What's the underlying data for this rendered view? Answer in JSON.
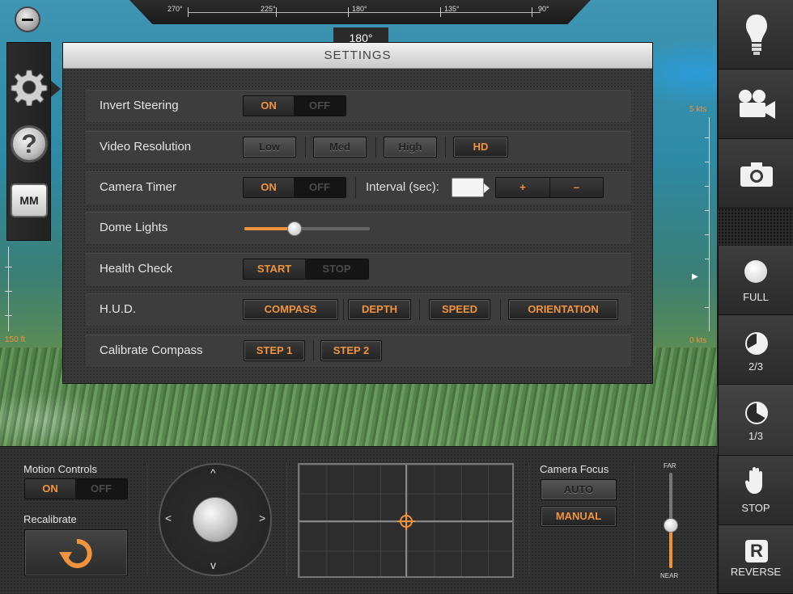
{
  "compass": {
    "ticks": [
      "270°",
      "225°",
      "180°",
      "135°",
      "90°"
    ],
    "heading": "180°"
  },
  "depth": {
    "max_label": "150 ft"
  },
  "speed": {
    "max_label": "5 kts",
    "min_label": "0 kts"
  },
  "left_tools": {
    "mm_label": "MM"
  },
  "settings": {
    "title": "SETTINGS",
    "invert_steering": {
      "label": "Invert Steering",
      "on": "ON",
      "off": "OFF",
      "value": "ON"
    },
    "video_resolution": {
      "label": "Video Resolution",
      "options": [
        "Low",
        "Med",
        "High",
        "HD"
      ],
      "selected": "HD"
    },
    "camera_timer": {
      "label": "Camera Timer",
      "on": "ON",
      "off": "OFF",
      "value": "ON",
      "interval_label": "Interval (sec):",
      "interval_value": "",
      "plus": "+",
      "minus": "–"
    },
    "dome_lights": {
      "label": "Dome Lights",
      "level": 0.4
    },
    "health_check": {
      "label": "Health Check",
      "start": "START",
      "stop": "STOP"
    },
    "hud": {
      "label": "H.U.D.",
      "options": [
        "COMPASS",
        "DEPTH",
        "SPEED",
        "ORIENTATION"
      ]
    },
    "calibrate_compass": {
      "label": "Calibrate Compass",
      "step1": "STEP 1",
      "step2": "STEP 2"
    }
  },
  "sidebar": {
    "light_icon": "lightbulb-icon",
    "video_icon": "video-camera-icon",
    "photo_icon": "camera-icon",
    "full": "FULL",
    "two_thirds": "2/3",
    "one_third": "1/3",
    "stop": "STOP",
    "reverse": "REVERSE",
    "reverse_letter": "R"
  },
  "bottom": {
    "motion_controls": "Motion Controls",
    "motion_on": "ON",
    "motion_off": "OFF",
    "recalibrate": "Recalibrate",
    "camera_focus": "Camera Focus",
    "auto": "AUTO",
    "manual": "MANUAL",
    "far": "FAR",
    "near": "NEAR",
    "focus_level": 0.45
  },
  "colors": {
    "accent": "#f0933f",
    "panel": "#3a3a3a"
  }
}
